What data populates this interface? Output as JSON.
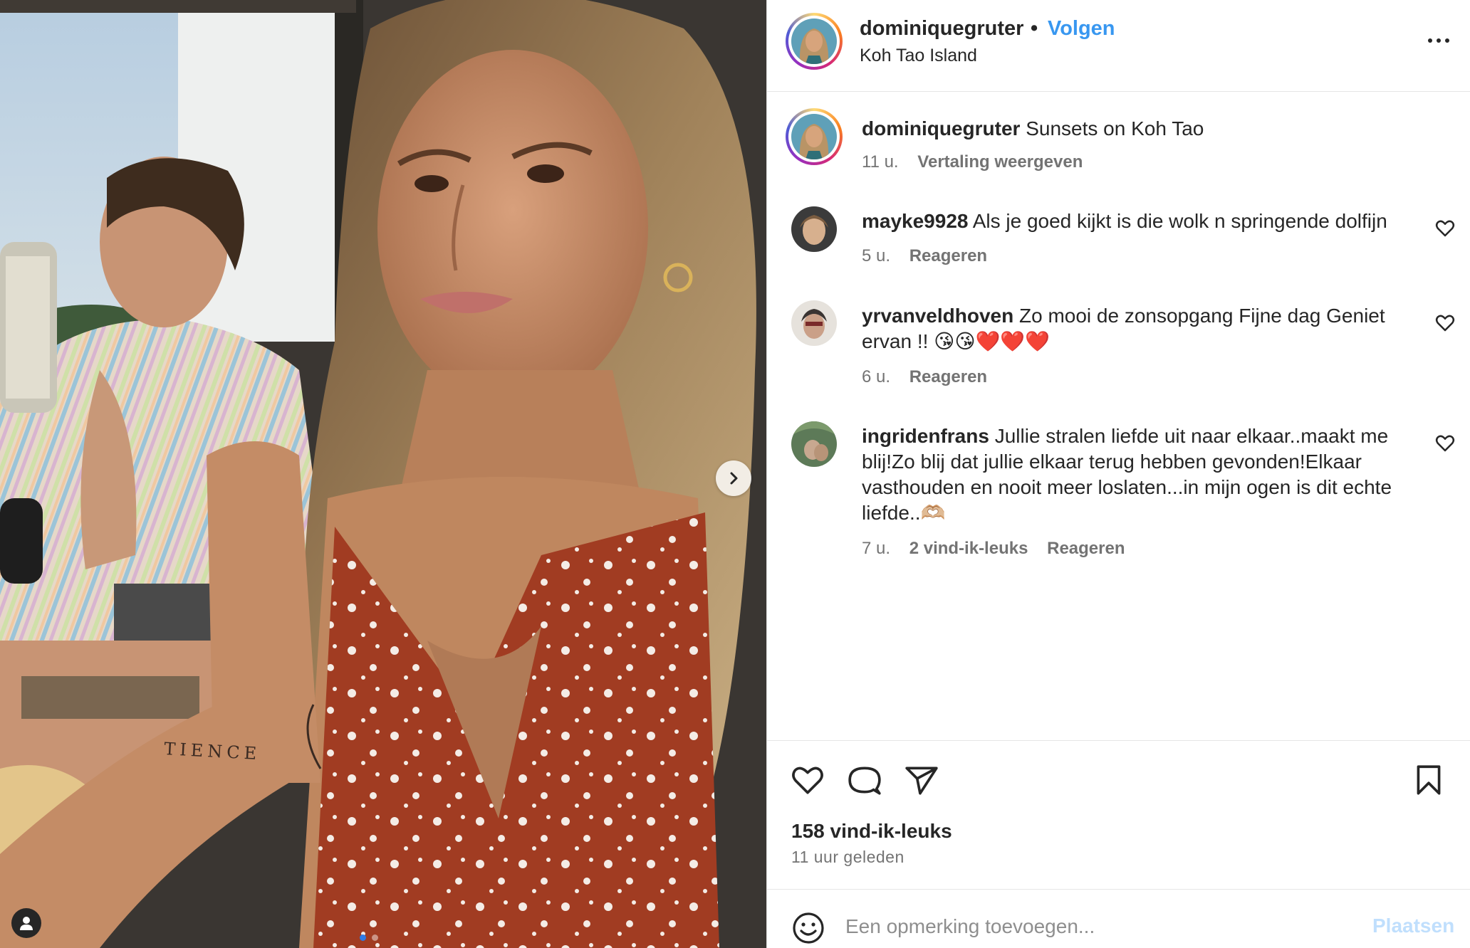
{
  "post": {
    "username": "dominiquegruter",
    "separator": "•",
    "follow_label": "Volgen",
    "location": "Koh Tao Island",
    "caption_text": "Sunsets on Koh Tao",
    "caption_time": "11 u.",
    "translate_label": "Vertaling weergeven"
  },
  "comments": [
    {
      "username": "mayke9928",
      "lines": [
        "Als je goed kijkt is die wolk n springende dolfijn"
      ],
      "time": "5 u.",
      "likes": "",
      "reply_label": "Reageren",
      "avatar_color": "#c9a68a"
    },
    {
      "username": "yrvanveldhoven",
      "lines": [
        "Zo mooi de zonsopgang Fijne dag Geniet",
        "ervan !! 😘😘❤️❤️❤️"
      ],
      "time": "6 u.",
      "likes": "",
      "reply_label": "Reageren",
      "avatar_color": "#8a7a6c"
    },
    {
      "username": "ingridenfrans",
      "lines": [
        "Jullie stralen liefde uit naar elkaar..maakt me",
        "blij!Zo blij dat jullie elkaar terug hebben gevonden!Elkaar",
        "vasthouden en nooit meer loslaten...in mijn ogen is dit echte",
        "liefde..🫶🏼"
      ],
      "time": "7 u.",
      "likes": "2 vind-ik-leuks",
      "reply_label": "Reageren",
      "avatar_color": "#6f8a6a"
    }
  ],
  "footer": {
    "likes_count": "158 vind-ik-leuks",
    "time_ago": "11 uur geleden",
    "comment_placeholder": "Een opmerking toevoegen...",
    "post_label": "Plaatsen"
  },
  "media": {
    "photo_text": "TIENCE"
  },
  "colors": {
    "accent": "#3897f0",
    "post_disabled": "#c0dffd",
    "muted": "#737373"
  }
}
